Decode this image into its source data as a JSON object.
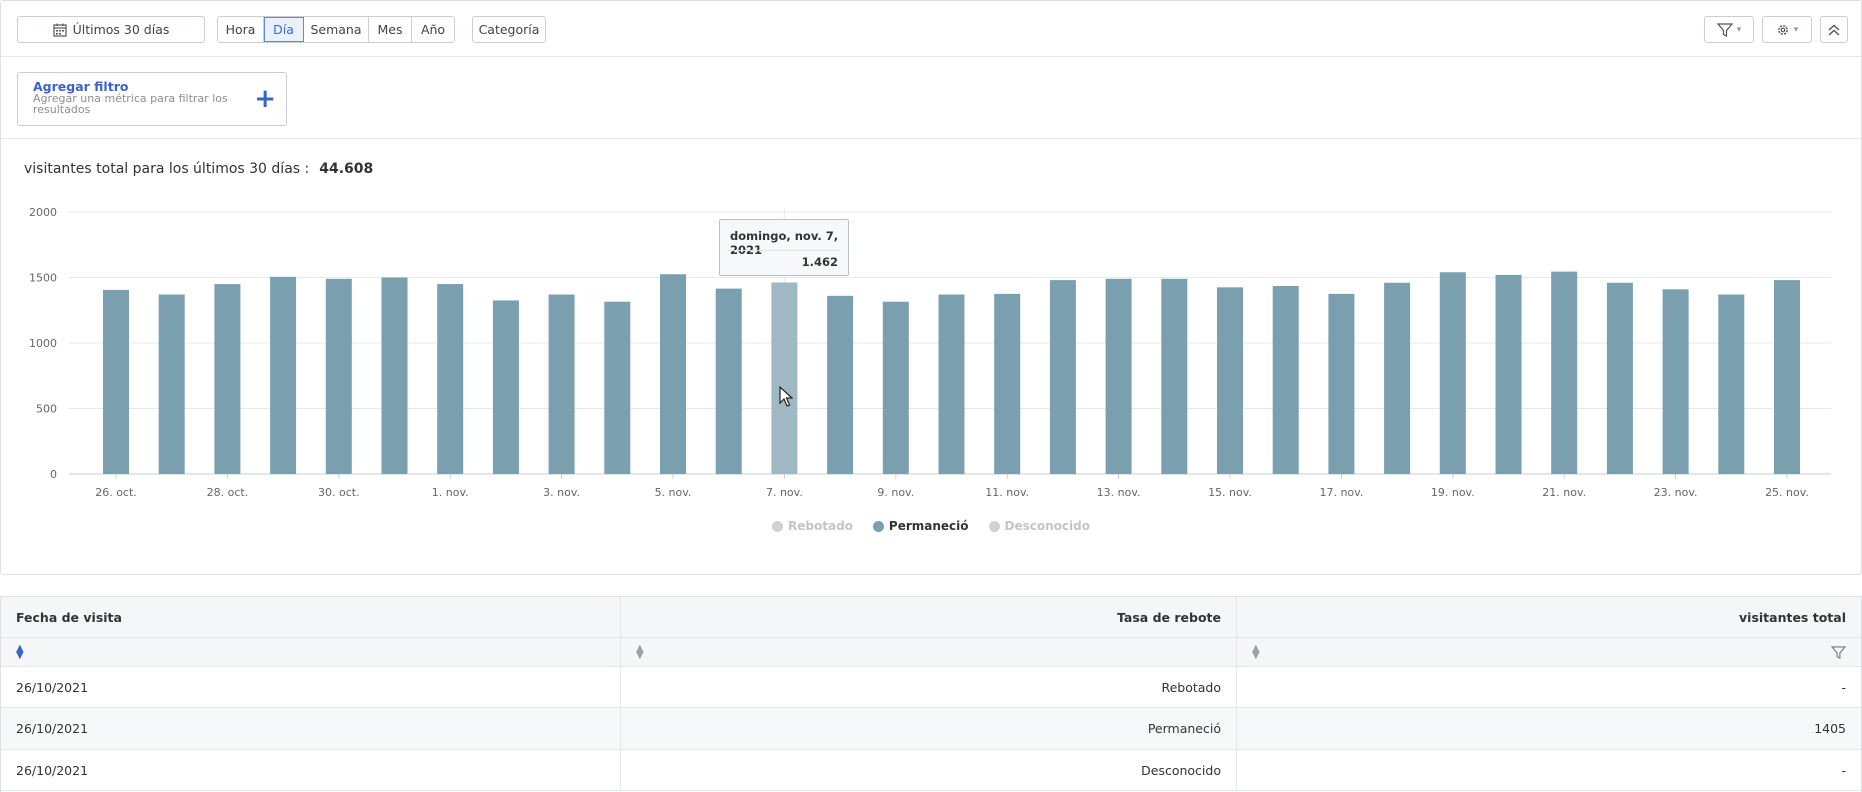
{
  "toolbar": {
    "date_range": "Últimos 30 días",
    "periods": [
      "Hora",
      "Día",
      "Semana",
      "Mes",
      "Año"
    ],
    "active_period": "Día",
    "category": "Categoría"
  },
  "filter": {
    "title": "Agregar filtro",
    "description": "Agregar una métrica para filtrar los resultados"
  },
  "summary": {
    "label": "visitantes total para los últimos 30 días :",
    "value": "44.608"
  },
  "tooltip": {
    "date": "domingo, nov. 7, 2021",
    "value": "1.462"
  },
  "legend": [
    {
      "name": "Rebotado",
      "color": "#cfd3d6"
    },
    {
      "name": "Permaneció",
      "color": "#7a9fae"
    },
    {
      "name": "Desconocido",
      "color": "#cfd3d6"
    }
  ],
  "chart_data": {
    "type": "bar",
    "categories": [
      "26. oct.",
      "27. oct.",
      "28. oct.",
      "29. oct.",
      "30. oct.",
      "31. oct.",
      "1. nov.",
      "2. nov.",
      "3. nov.",
      "4. nov.",
      "5. nov.",
      "6. nov.",
      "7. nov.",
      "8. nov.",
      "9. nov.",
      "10. nov.",
      "11. nov.",
      "12. nov.",
      "13. nov.",
      "14. nov.",
      "15. nov.",
      "16. nov.",
      "17. nov.",
      "18. nov.",
      "19. nov.",
      "20. nov.",
      "21. nov.",
      "22. nov.",
      "23. nov.",
      "24. nov.",
      "25. nov."
    ],
    "tick_labels": [
      "26. oct.",
      "28. oct.",
      "30. oct.",
      "1. nov.",
      "3. nov.",
      "5. nov.",
      "7. nov.",
      "9. nov.",
      "11. nov.",
      "13. nov.",
      "15. nov.",
      "17. nov.",
      "19. nov.",
      "21. nov.",
      "23. nov.",
      "25. nov."
    ],
    "series": [
      {
        "name": "Permaneció",
        "values": [
          1405,
          1370,
          1450,
          1505,
          1490,
          1500,
          1450,
          1325,
          1370,
          1315,
          1525,
          1415,
          1462,
          1360,
          1315,
          1370,
          1375,
          1480,
          1490,
          1490,
          1425,
          1435,
          1375,
          1460,
          1540,
          1520,
          1545,
          1460,
          1410,
          1370,
          1480
        ]
      }
    ],
    "highlight_index": 12,
    "ylim": [
      0,
      2000
    ],
    "yticks": [
      0,
      500,
      1000,
      1500,
      2000
    ],
    "grid": true,
    "legend_position": "bottom-center",
    "bar_color": "#7a9fae",
    "highlight_color": "#9fb8c3"
  },
  "table": {
    "headers": [
      "Fecha de visita",
      "Tasa de rebote",
      "visitantes total"
    ],
    "rows": [
      [
        "26/10/2021",
        "Rebotado",
        "-"
      ],
      [
        "26/10/2021",
        "Permaneció",
        "1405"
      ],
      [
        "26/10/2021",
        "Desconocido",
        "-"
      ]
    ]
  }
}
